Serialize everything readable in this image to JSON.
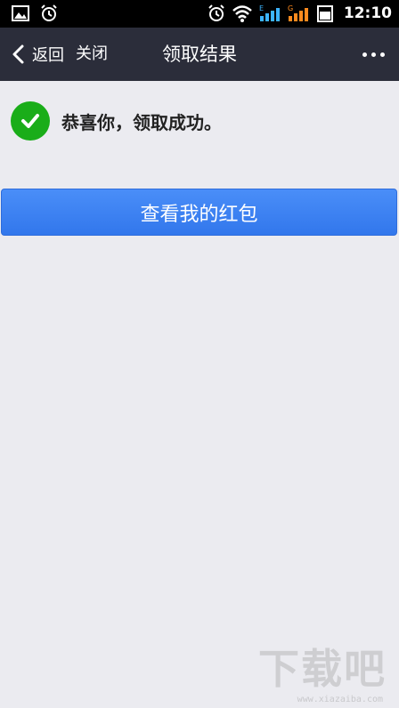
{
  "status_bar": {
    "time": "12:10",
    "icons": [
      "gallery-icon",
      "alarm-icon",
      "alarm-icon",
      "wifi-icon",
      "signal-e-icon",
      "signal-g-icon",
      "battery-icon"
    ]
  },
  "nav": {
    "back_label": "返回",
    "close_label": "关闭",
    "title": "领取结果",
    "more_icon": "more-icon"
  },
  "content": {
    "success_message": "恭喜你，领取成功。",
    "primary_button_label": "查看我的红包"
  },
  "watermark": {
    "main": "下载吧",
    "url": "www.xiazaiba.com"
  },
  "colors": {
    "status_bar_bg": "#000000",
    "nav_bg": "#2b2d3a",
    "page_bg": "#ebebf0",
    "success_green": "#1aad19",
    "button_blue": "#3a7ff0"
  }
}
